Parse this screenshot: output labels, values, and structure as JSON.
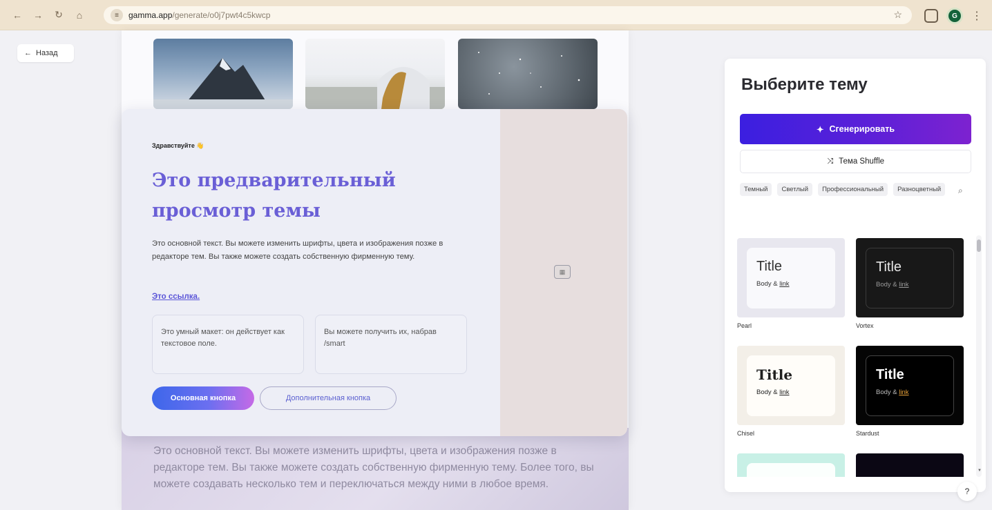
{
  "browser": {
    "url_host": "gamma.app",
    "url_path": "/generate/o0j7pwt4c5kwcp",
    "avatar_letter": "G",
    "icons": [
      "back-icon",
      "forward-icon",
      "reload-icon",
      "home-icon",
      "tune-icon",
      "star-icon",
      "extensions-icon",
      "kebab-icon"
    ]
  },
  "back_label": "Назад",
  "preview": {
    "greeting": "Здравствуйте 👋",
    "heading": "Это предварительный просмотр темы",
    "body": "Это основной текст. Вы можете изменить шрифты, цвета и изображения позже в редакторе тем. Вы также можете создать собственную фирменную тему.",
    "link": "Это ссылка.",
    "smart_box_1": "Это умный макет: он действует как текстовое поле.",
    "smart_box_2": "Вы можете получить их, набрав /smart",
    "primary_button": "Основная кнопка",
    "secondary_button": "Дополнительная кнопка"
  },
  "background_text": "Это основной текст. Вы можете изменить шрифты, цвета и изображения позже в редакторе тем. Вы также можете создать собственную фирменную тему. Более того, вы можете создавать несколько тем и переключаться между ними в любое время.",
  "panel": {
    "title": "Выберите тему",
    "generate_label": "Сгенерировать",
    "shuffle_label": "Тема Shuffle",
    "chips": [
      "Темный",
      "Светлый",
      "Профессиональный",
      "Разноцветный"
    ],
    "theme_title": "Title",
    "theme_body": "Body & ",
    "theme_link": "link",
    "themes": [
      {
        "name": "Pearl"
      },
      {
        "name": "Vortex"
      },
      {
        "name": "Chisel"
      },
      {
        "name": "Stardust"
      }
    ]
  },
  "help_label": "?",
  "colors": {
    "accent": "#5b20d8",
    "heading": "#6a5fd6",
    "link": "#5b55d8"
  }
}
